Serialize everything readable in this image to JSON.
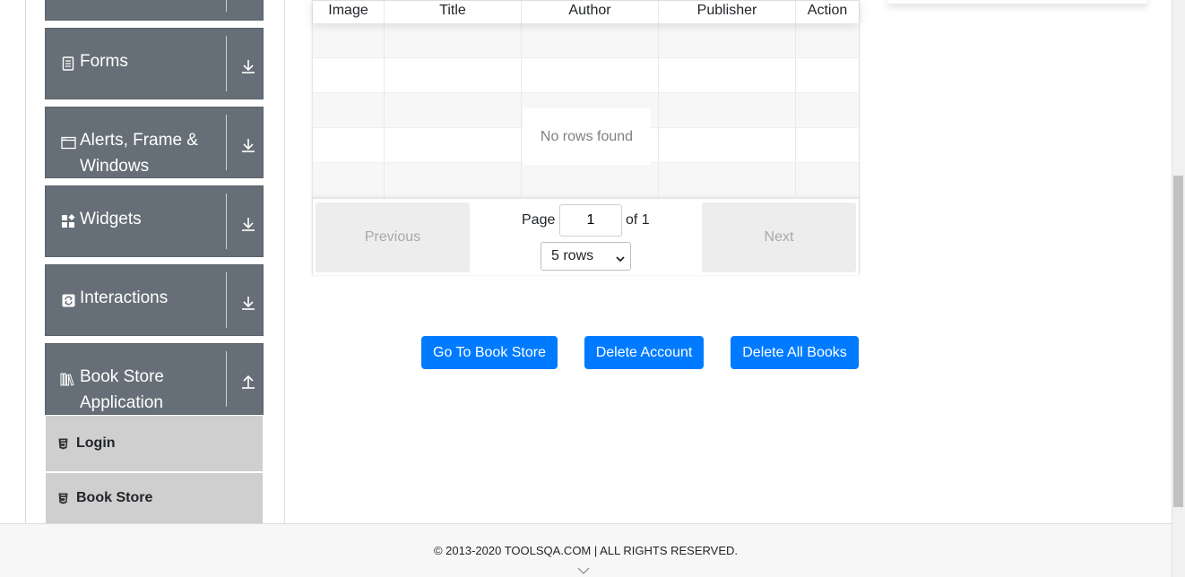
{
  "sidebar": {
    "groups": [
      {
        "title": "Forms",
        "icon": "form-icon",
        "arrow": "download-arrow-icon"
      },
      {
        "title_line1": "Alerts, Frame &",
        "title_line2": "Windows",
        "icon": "window-icon",
        "arrow": "download-arrow-icon"
      },
      {
        "title": "Widgets",
        "icon": "widgets-icon",
        "arrow": "download-arrow-icon"
      },
      {
        "title": "Interactions",
        "icon": "interactions-icon",
        "arrow": "download-arrow-icon"
      },
      {
        "title_line1": "Book Store",
        "title_line2": "Application",
        "icon": "books-icon",
        "arrow": "upload-arrow-icon"
      }
    ],
    "subitems": [
      {
        "label": "Login",
        "icon": "html5-icon"
      },
      {
        "label": "Book Store",
        "icon": "html5-icon"
      }
    ],
    "colors": {
      "group_bg": "#666f77",
      "subitem_bg": "#cfcfcf"
    }
  },
  "table": {
    "columns": [
      "Image",
      "Title",
      "Author",
      "Publisher",
      "Action"
    ],
    "empty_message": "No rows found",
    "pagination": {
      "previous_label": "Previous",
      "next_label": "Next",
      "page_label": "Page",
      "page_value": "1",
      "of_label": "of 1",
      "rows_option": "5 rows"
    }
  },
  "actions": {
    "go_to_store": "Go To Book Store",
    "delete_account": "Delete Account",
    "delete_all_books": "Delete All Books",
    "button_color": "#007bff"
  },
  "footer": {
    "text": "© 2013-2020 TOOLSQA.COM | ALL RIGHTS RESERVED."
  }
}
